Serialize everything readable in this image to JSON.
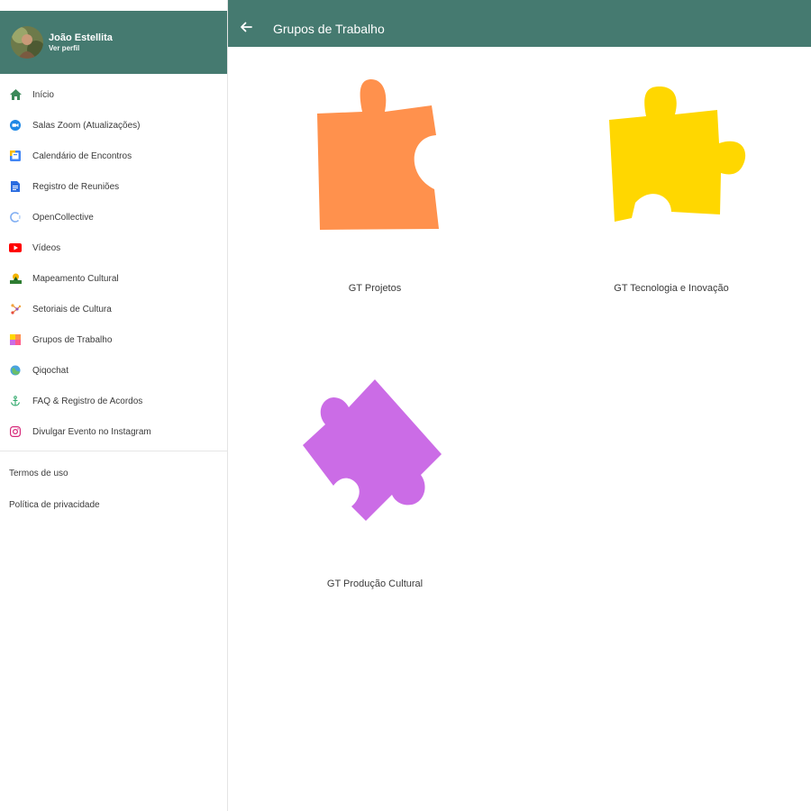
{
  "colors": {
    "header": "#457a70",
    "puzzle_orange": "#ff914d",
    "puzzle_yellow": "#ffd700",
    "puzzle_purple": "#cb6ce6"
  },
  "profile": {
    "name": "João Estellita",
    "link": "Ver perfil"
  },
  "menu": [
    {
      "label": "Início",
      "icon": "home-icon"
    },
    {
      "label": "Salas Zoom (Atualizações)",
      "icon": "zoom-icon"
    },
    {
      "label": "Calendário de Encontros",
      "icon": "calendar-icon"
    },
    {
      "label": "Registro de Reuniões",
      "icon": "document-icon"
    },
    {
      "label": "OpenCollective",
      "icon": "opencollective-icon"
    },
    {
      "label": "Vídeos",
      "icon": "youtube-icon"
    },
    {
      "label": "Mapeamento Cultural",
      "icon": "map-icon"
    },
    {
      "label": "Setoriais de Cultura",
      "icon": "network-icon"
    },
    {
      "label": "Grupos de Trabalho",
      "icon": "puzzle-icon"
    },
    {
      "label": "Qiqochat",
      "icon": "globe-icon"
    },
    {
      "label": "FAQ & Registro de Acordos",
      "icon": "anchor-icon"
    },
    {
      "label": "Divulgar Evento no Instagram",
      "icon": "instagram-icon"
    }
  ],
  "footer_links": [
    "Termos de uso",
    "Política de privacidade"
  ],
  "appbar": {
    "title": "Grupos de Trabalho"
  },
  "groups": [
    {
      "label": "GT Projetos",
      "icon": "puzzle-orange-icon"
    },
    {
      "label": "GT Tecnologia e Inovação",
      "icon": "puzzle-yellow-icon"
    },
    {
      "label": "GT Produção Cultural",
      "icon": "puzzle-purple-icon"
    }
  ]
}
